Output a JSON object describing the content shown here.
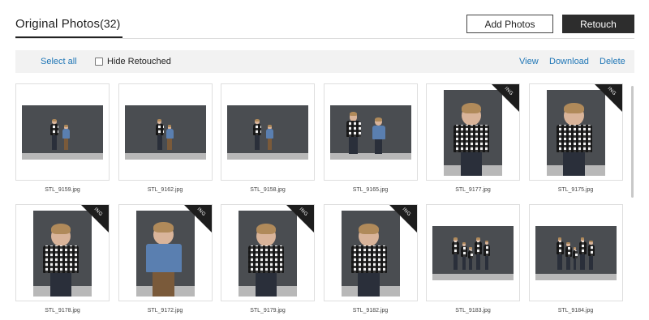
{
  "header": {
    "title": "Original Photos",
    "count": "(32)",
    "add_photos_label": "Add Photos",
    "retouch_label": "Retouch"
  },
  "toolbar": {
    "select_all": "Select all",
    "hide_retouched": "Hide Retouched",
    "hide_retouched_checked": false,
    "view": "View",
    "download": "Download",
    "delete": "Delete"
  },
  "badge_label": "ING",
  "colors": {
    "link": "#1f76b6",
    "primary_button": "#2d2d2d",
    "toolbar_bg": "#f2f2f2"
  },
  "photos": [
    {
      "filename": "STL_9159.jpg",
      "orientation": "landscape",
      "badge": false
    },
    {
      "filename": "STL_9162.jpg",
      "orientation": "landscape",
      "badge": false
    },
    {
      "filename": "STL_9158.jpg",
      "orientation": "landscape",
      "badge": false
    },
    {
      "filename": "STL_9165.jpg",
      "orientation": "landscape",
      "badge": false
    },
    {
      "filename": "STL_9177.jpg",
      "orientation": "portrait",
      "badge": true
    },
    {
      "filename": "STL_9175.jpg",
      "orientation": "portrait",
      "badge": true
    },
    {
      "filename": "STL_9178.jpg",
      "orientation": "portrait",
      "badge": true
    },
    {
      "filename": "STL_9172.jpg",
      "orientation": "portrait",
      "badge": true
    },
    {
      "filename": "STL_9179.jpg",
      "orientation": "portrait",
      "badge": true
    },
    {
      "filename": "STL_9182.jpg",
      "orientation": "portrait",
      "badge": true
    },
    {
      "filename": "STL_9183.jpg",
      "orientation": "landscape",
      "badge": false
    },
    {
      "filename": "STL_9184.jpg",
      "orientation": "landscape",
      "badge": false
    }
  ]
}
